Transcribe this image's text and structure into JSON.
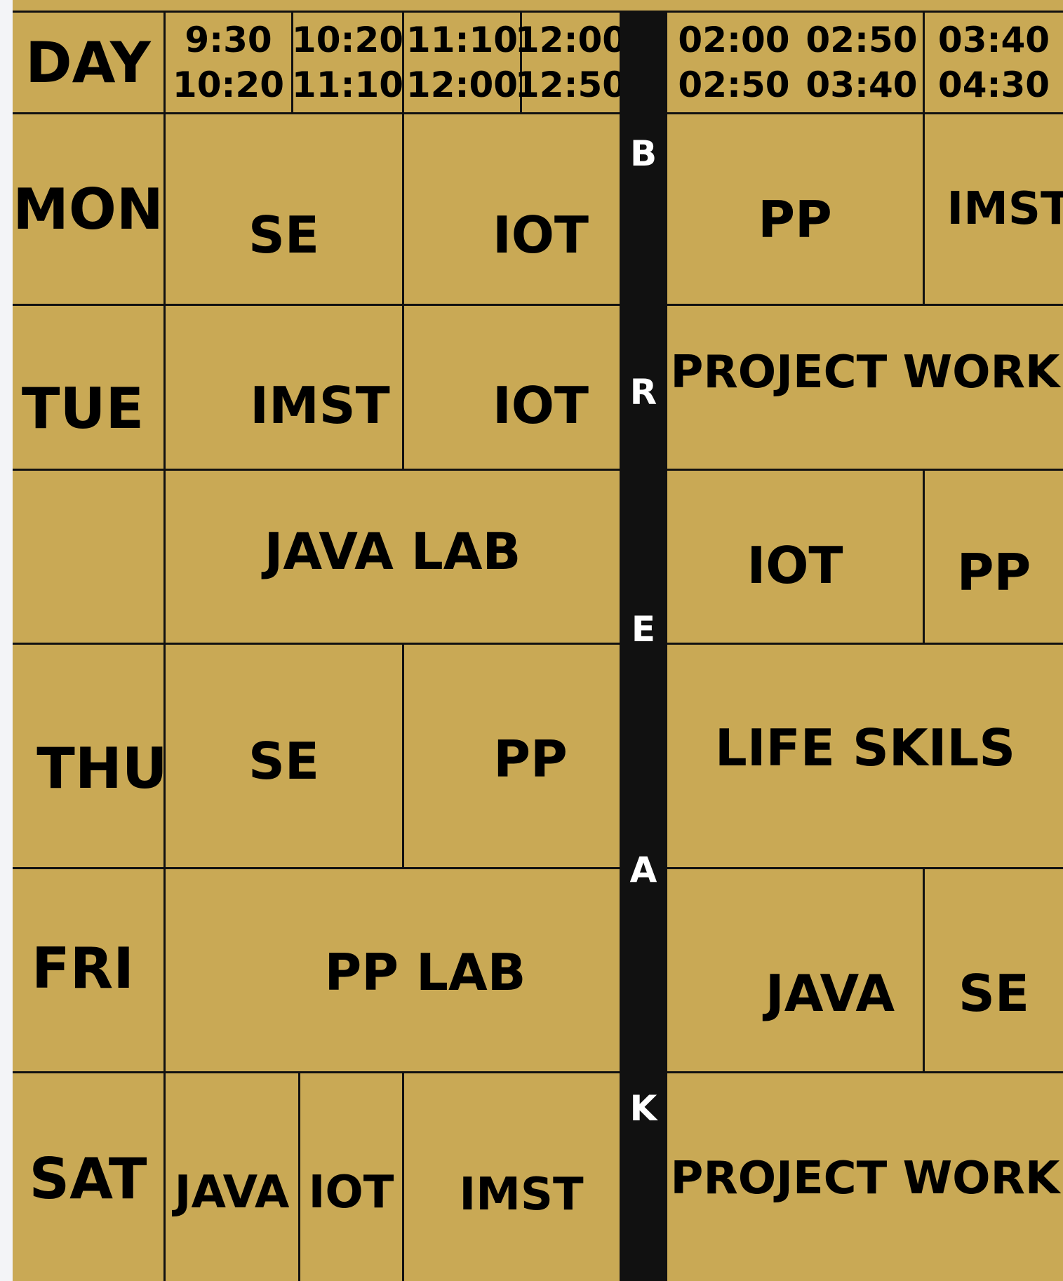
{
  "header": {
    "day_label": "DAY",
    "slots": [
      {
        "start": "9:30",
        "end": "10:20"
      },
      {
        "start": "10:20",
        "end": "11:10"
      },
      {
        "start": "11:10",
        "end": "12:00"
      },
      {
        "start": "12:00",
        "end": "12:50"
      },
      {
        "start": "02:00",
        "end": "02:50"
      },
      {
        "start": "02:50",
        "end": "03:40"
      },
      {
        "start": "03:40",
        "end": "04:30"
      }
    ]
  },
  "break_letters": [
    "B",
    "R",
    "E",
    "A",
    "K"
  ],
  "days": {
    "mon": {
      "label": "MON",
      "cells": [
        "SE",
        "IOT",
        "PP",
        "IMST"
      ]
    },
    "tue": {
      "label": "TUE",
      "cells": [
        "IMST",
        "IOT",
        "PROJECT WORK"
      ]
    },
    "wed": {
      "label": "",
      "cells": [
        "JAVA LAB",
        "IOT",
        "PP"
      ]
    },
    "thu": {
      "label": "THU",
      "cells": [
        "SE",
        "PP",
        "LIFE SKILS"
      ]
    },
    "fri": {
      "label": "FRI",
      "cells": [
        "PP LAB",
        "JAVA",
        "SE"
      ]
    },
    "sat": {
      "label": "SAT",
      "cells": [
        "JAVA",
        "IOT",
        "IMST",
        "PROJECT WORK"
      ]
    }
  },
  "colors": {
    "background": "#c9a955",
    "grid_lines": "#111111",
    "break_bar": "#111111",
    "break_text": "#ffffff",
    "page_margin": "#f3f4f7"
  }
}
